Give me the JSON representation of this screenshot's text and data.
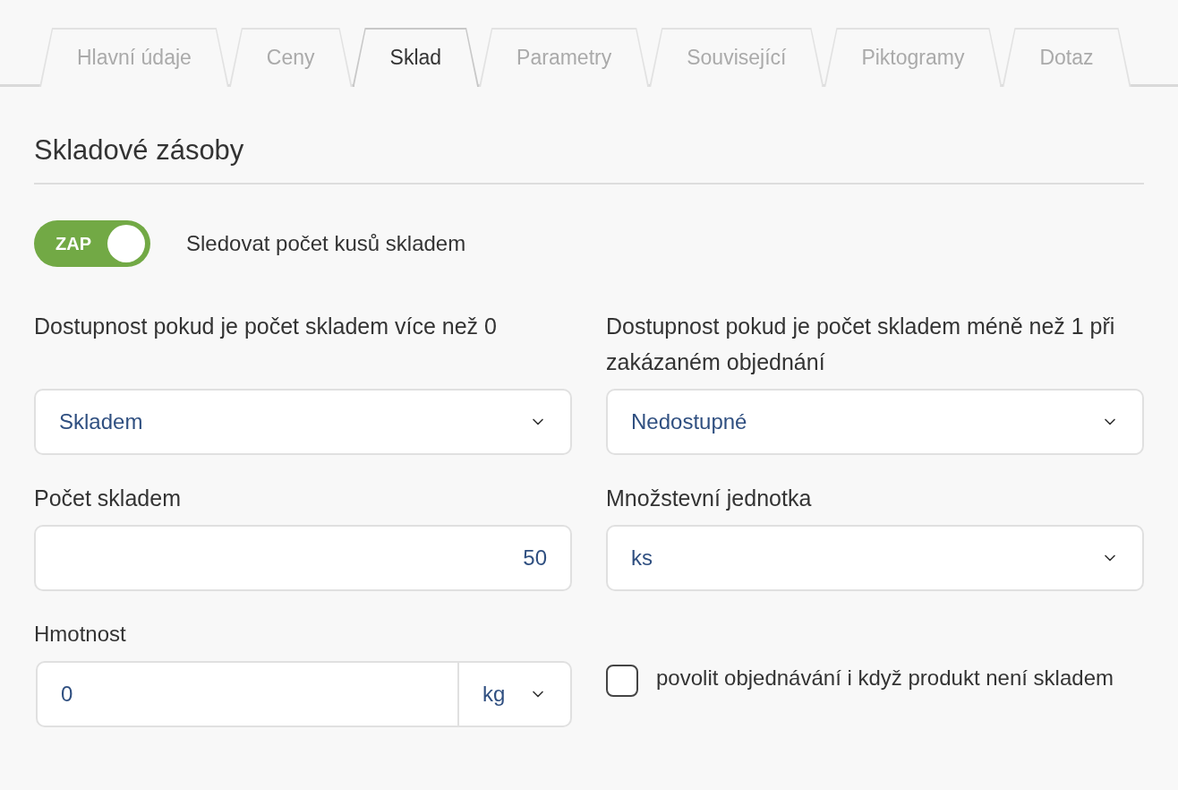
{
  "tabs": [
    {
      "label": "Hlavní údaje",
      "selected": false
    },
    {
      "label": "Ceny",
      "selected": false
    },
    {
      "label": "Sklad",
      "selected": true
    },
    {
      "label": "Parametry",
      "selected": false
    },
    {
      "label": "Související",
      "selected": false
    },
    {
      "label": "Piktogramy",
      "selected": false
    },
    {
      "label": "Dotaz",
      "selected": false
    }
  ],
  "section_title": "Skladové zásoby",
  "stock_tracking": {
    "badge": "ZAP",
    "on": true,
    "label": "Sledovat počet kusů skladem"
  },
  "fields": [
    {
      "kind": "select",
      "label": "Dostupnost pokud je počet skladem více než 0",
      "value": "Skladem"
    },
    {
      "kind": "select",
      "label": "Dostupnost pokud je počet skladem méně než 1 při zakázaném objednání",
      "value": "Nedostupné"
    },
    {
      "kind": "number",
      "label": "Počet skladem",
      "value": "50"
    },
    {
      "kind": "select",
      "label": "Množstevní jednotka",
      "value": "ks"
    }
  ],
  "weight": {
    "label": "Hmotnost",
    "value": "0",
    "unit": "kg"
  },
  "allow_backorder": {
    "label": "povolit objednávání i když produkt není skladem",
    "checked": false
  }
}
